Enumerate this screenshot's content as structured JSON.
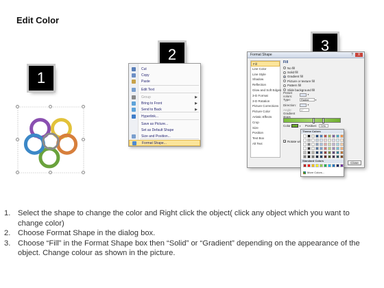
{
  "page": {
    "title": "Edit Color"
  },
  "steps": [
    {
      "badge": "1"
    },
    {
      "badge": "2"
    },
    {
      "badge": "3"
    }
  ],
  "shape": {
    "ring_colors": [
      "#8a4fb0",
      "#e2c23a",
      "#d77f3c",
      "#6aa23c",
      "#3c88c7",
      "#8b8b8b"
    ]
  },
  "context_menu": {
    "items": [
      {
        "label": "Cut",
        "icon": "scissors-icon",
        "disabled": false
      },
      {
        "label": "Copy",
        "icon": "copy-icon",
        "disabled": false
      },
      {
        "label": "Paste",
        "icon": "paste-icon",
        "disabled": false
      },
      {
        "label": "Edit Text",
        "icon": "edit-text-icon",
        "disabled": false
      },
      {
        "label": "Group",
        "icon": "group-icon",
        "disabled": true,
        "submenu": true
      },
      {
        "label": "Bring to Front",
        "icon": "bring-front-icon",
        "disabled": false,
        "submenu": true
      },
      {
        "label": "Send to Back",
        "icon": "send-back-icon",
        "disabled": false,
        "submenu": true
      },
      {
        "label": "Hyperlink...",
        "icon": "hyperlink-icon",
        "disabled": false
      },
      {
        "label": "Save as Picture...",
        "icon": "",
        "disabled": false
      },
      {
        "label": "Set as Default Shape",
        "icon": "",
        "disabled": false
      },
      {
        "label": "Size and Position...",
        "icon": "size-position-icon",
        "disabled": false
      },
      {
        "label": "Format Shape...",
        "icon": "format-shape-icon",
        "disabled": false,
        "highlight": true
      }
    ]
  },
  "dialog": {
    "title": "Format Shape",
    "help": "?",
    "close": "X",
    "nav": [
      "Fill",
      "Line Color",
      "Line Style",
      "Shadow",
      "Reflection",
      "Glow and Soft Edges",
      "3-D Format",
      "3-D Rotation",
      "Picture Corrections",
      "Picture Color",
      "Artistic Effects",
      "Crop",
      "Size",
      "Position",
      "Text Box",
      "Alt Text"
    ],
    "active_nav": "Fill",
    "pane_heading": "Fill",
    "options": [
      {
        "label": "No fill",
        "selected": false
      },
      {
        "label": "Solid fill",
        "selected": false
      },
      {
        "label": "Gradient fill",
        "selected": true
      },
      {
        "label": "Picture or texture fill",
        "selected": false
      },
      {
        "label": "Pattern fill",
        "selected": false
      },
      {
        "label": "Slide background fill",
        "selected": false
      }
    ],
    "preset_label": "Preset colors:",
    "type_label": "Type:",
    "type_value": "Radial",
    "direction_label": "Direction:",
    "angle_label": "Angle:",
    "angle_value": "0°",
    "gradient_label": "Gradient stops",
    "color_label": "Color",
    "position_label": "Position:",
    "position_value": "72%",
    "brightness_label": "Brightness:",
    "transparency_label": "Transparency:",
    "rotate_label": "Rotate with shape",
    "close_button": "Close"
  },
  "color_popup": {
    "theme_heading": "Theme Colors",
    "standard_heading": "Standard Colors",
    "more_label": "More Colors...",
    "theme_top": [
      "#ffffff",
      "#000000",
      "#eeece1",
      "#1f497d",
      "#4f81bd",
      "#c0504d",
      "#9bbb59",
      "#8064a2",
      "#4bacc6",
      "#f79646"
    ],
    "standard": [
      "#c00000",
      "#ff0000",
      "#ffc000",
      "#ffff00",
      "#92d050",
      "#00b050",
      "#00b0f0",
      "#0070c0",
      "#002060",
      "#7030a0"
    ]
  },
  "instructions": [
    {
      "num": "1.",
      "text": "Select the shape to change the color and Right click the object( click any object which you want to change color)"
    },
    {
      "num": "2.",
      "text": "Choose Format Shape in the dialog box."
    },
    {
      "num": "3.",
      "text": "Choose “Fill” in the Format Shape box then “Solid” or “Gradient” depending on the appearance of the object. Change colour as shown in the picture."
    }
  ]
}
